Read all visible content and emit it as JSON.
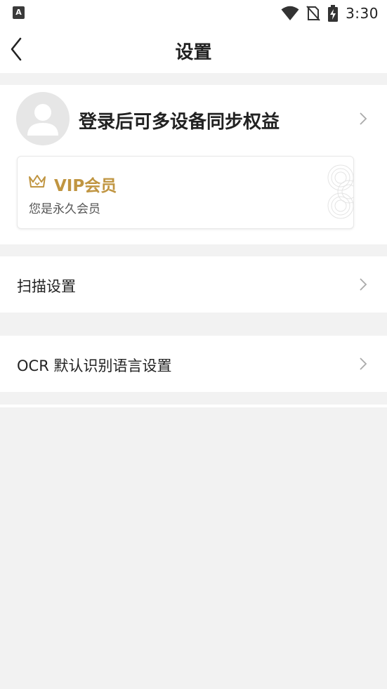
{
  "status_bar": {
    "app_icon_letter": "A",
    "time": "3:30",
    "icons": [
      "app-notification-icon",
      "wifi-icon",
      "no-sim-icon",
      "battery-charging-icon"
    ]
  },
  "header": {
    "title": "设置",
    "back_icon": "chevron-left-icon"
  },
  "account": {
    "avatar_icon": "user-avatar-icon",
    "login_prompt": "登录后可多设备同步权益",
    "vip": {
      "icon": "crown-icon",
      "title": "VIP会员",
      "subtitle": "您是永久会员",
      "accent_color": "#c09541"
    }
  },
  "menu": {
    "items": [
      {
        "label": "扫描设置"
      },
      {
        "label": "OCR 默认识别语言设置"
      }
    ]
  },
  "colors": {
    "background": "#f2f2f2",
    "surface": "#ffffff",
    "text": "#222222",
    "chevron": "#aaaaaa"
  }
}
